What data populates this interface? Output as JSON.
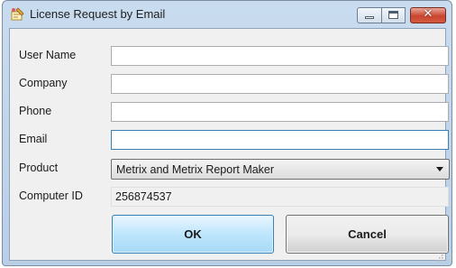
{
  "window": {
    "title": "License Request by Email",
    "close_glyph": "✕",
    "icon": "pencil-certificate-icon"
  },
  "form": {
    "user_name": {
      "label": "User Name",
      "value": ""
    },
    "company": {
      "label": "Company",
      "value": ""
    },
    "phone": {
      "label": "Phone",
      "value": ""
    },
    "email": {
      "label": "Email",
      "value": ""
    },
    "product": {
      "label": "Product",
      "value": "Metrix and Metrix Report Maker"
    },
    "computer_id": {
      "label": "Computer ID",
      "value": "256874537"
    }
  },
  "buttons": {
    "ok_label": "OK",
    "cancel_label": "Cancel"
  },
  "colors": {
    "title_bar": "#c9dcef",
    "client_bg": "#f0f0f0",
    "focus_border": "#3c7fb1",
    "close_button": "#c9452f"
  }
}
